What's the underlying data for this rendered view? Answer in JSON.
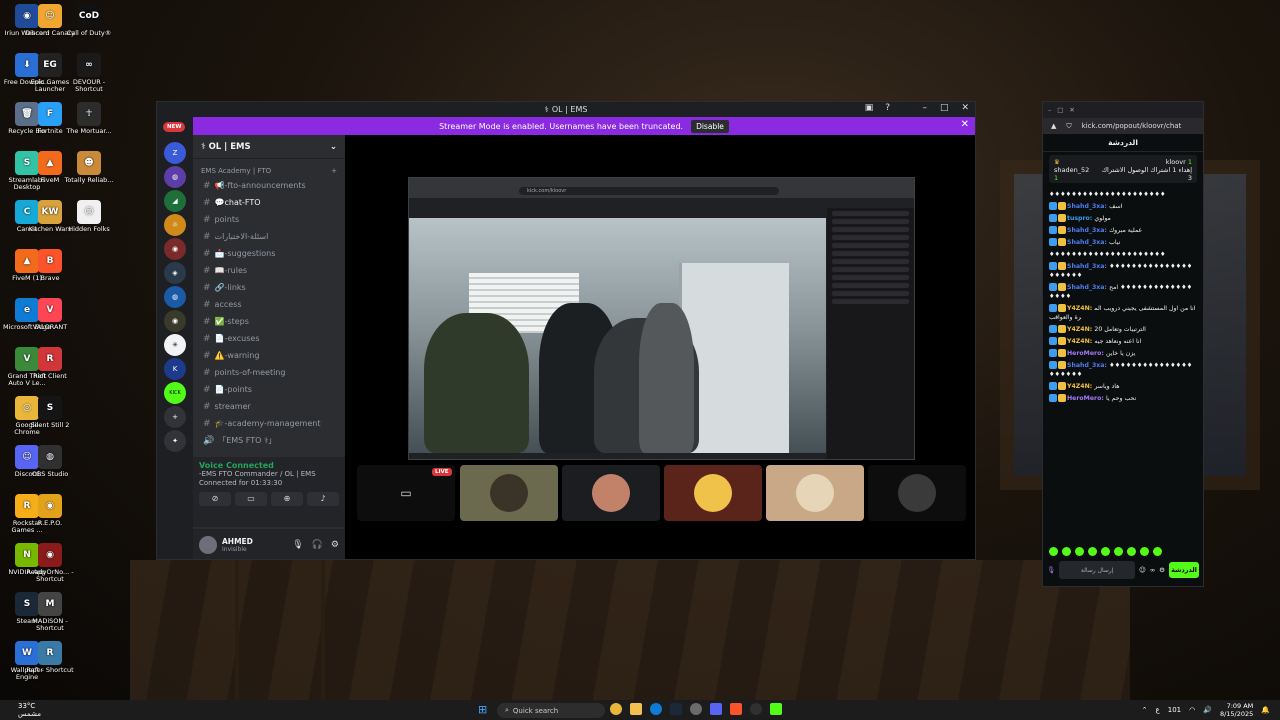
{
  "desktop": {
    "icons": [
      {
        "label": "Iriun Webcam",
        "color": "#1f4b99",
        "glyph": "◉"
      },
      {
        "label": "Discord Canary",
        "color": "#f0a732",
        "glyph": "☺"
      },
      {
        "label": "Call of Duty®",
        "color": "#111111",
        "glyph": "CoD"
      },
      {
        "label": "Free Downlo...",
        "color": "#2a6fd6",
        "glyph": "⬇"
      },
      {
        "label": "Epic Games Launcher",
        "color": "#222222",
        "glyph": "EG"
      },
      {
        "label": "DEVOUR - Shortcut",
        "color": "#1a1a1a",
        "glyph": "∞"
      },
      {
        "label": "Recycle Bin",
        "color": "#5b6f8a",
        "glyph": "🗑"
      },
      {
        "label": "Fortnite",
        "color": "#29a0f5",
        "glyph": "F"
      },
      {
        "label": "The Mortuar...",
        "color": "#2c2c2c",
        "glyph": "☥"
      },
      {
        "label": "Streamlabs Desktop",
        "color": "#32c3a6",
        "glyph": "S"
      },
      {
        "label": "FiveM",
        "color": "#f26b1d",
        "glyph": "▲"
      },
      {
        "label": "Totally Reliab...",
        "color": "#c98a3a",
        "glyph": "☻"
      },
      {
        "label": "Canva",
        "color": "#14a9d6",
        "glyph": "C"
      },
      {
        "label": "Kitchen Wars",
        "color": "#d9a23c",
        "glyph": "KW"
      },
      {
        "label": "Hidden Folks",
        "color": "#f0f0f0",
        "glyph": "☺"
      },
      {
        "label": "FiveM (1)",
        "color": "#f26b1d",
        "glyph": "▲"
      },
      {
        "label": "Brave",
        "color": "#fb542b",
        "glyph": "B"
      },
      {
        "label": "Microsoft Edge",
        "color": "#0f7bd4",
        "glyph": "e"
      },
      {
        "label": "VALORANT",
        "color": "#ff4655",
        "glyph": "V"
      },
      {
        "label": "Grand Theft Auto V Le...",
        "color": "#3a8a3a",
        "glyph": "V"
      },
      {
        "label": "Riot Client",
        "color": "#d13639",
        "glyph": "R"
      },
      {
        "label": "Google Chrome",
        "color": "#e9b63b",
        "glyph": "◎"
      },
      {
        "label": "Silent Still 2",
        "color": "#151515",
        "glyph": "S"
      },
      {
        "label": "Discord",
        "color": "#5865f2",
        "glyph": "☺"
      },
      {
        "label": "OBS Studio",
        "color": "#303030",
        "glyph": "◍"
      },
      {
        "label": "Rockstar Games ...",
        "color": "#f6ad1a",
        "glyph": "R"
      },
      {
        "label": "R.E.P.O.",
        "color": "#e2a21a",
        "glyph": "◉"
      },
      {
        "label": "NVIDIA App",
        "color": "#76b900",
        "glyph": "N"
      },
      {
        "label": "ReadyOrNo... - Shortcut",
        "color": "#8b1a1a",
        "glyph": "◉"
      },
      {
        "label": "Steam",
        "color": "#1b2838",
        "glyph": "S"
      },
      {
        "label": "MADiSON - Shortcut",
        "color": "#444444",
        "glyph": "M"
      },
      {
        "label": "Wallpaper Engine",
        "color": "#2a6fd6",
        "glyph": "W"
      },
      {
        "label": "Raft - Shortcut",
        "color": "#3a7aa6",
        "glyph": "R"
      }
    ]
  },
  "discord": {
    "title": "OL | EMS",
    "new_badge": "NEW",
    "banner_text": "Streamer Mode is enabled. Usernames have been truncated.",
    "banner_button": "Disable",
    "server_name": "OL | EMS",
    "category": "EMS Academy | FTO",
    "channels": [
      {
        "icon": "#",
        "name": "📢-fto-announcements"
      },
      {
        "icon": "#",
        "name": "💬chat-FTO",
        "active": true
      },
      {
        "icon": "#",
        "name": "points"
      },
      {
        "icon": "#",
        "name": "اسئلة-الاختبارات"
      },
      {
        "icon": "#",
        "name": "📩-suggestions"
      },
      {
        "icon": "#",
        "name": "📖-rules"
      },
      {
        "icon": "#",
        "name": "🔗-links"
      },
      {
        "icon": "#",
        "name": "access"
      },
      {
        "icon": "#",
        "name": "✅-steps"
      },
      {
        "icon": "#",
        "name": "📄-excuses"
      },
      {
        "icon": "#",
        "name": "⚠️-warning"
      },
      {
        "icon": "#",
        "name": "points-of-meeting"
      },
      {
        "icon": "#",
        "name": "📄-points"
      },
      {
        "icon": "#",
        "name": "streamer"
      },
      {
        "icon": "#",
        "name": "🎓-academy-management"
      },
      {
        "icon": "🔊",
        "name": "「EMS FTO ⚕」"
      }
    ],
    "voice": {
      "status": "Voice Connected",
      "channel": "-EMS FTO Commander / OL | EMS",
      "timer": "Connected for 01:33:30"
    },
    "user": {
      "name": "AHMED",
      "status": "Invisible"
    },
    "stream": {
      "url": "kick.com/kloovr",
      "live_label": "LIVE"
    }
  },
  "kick": {
    "url": "kick.com/popout/kloovr/chat",
    "header": "الدردشة",
    "pinned_user": "shaden_52",
    "pinned_host": "kloovr",
    "pinned_text": "إهداء 1 اشتراك الوصول الاشتراك 3",
    "pinned_count_a": "1",
    "pinned_count_b": "1",
    "messages": [
      {
        "user": "",
        "text": "♦♦♦♦♦♦♦♦♦♦♦♦♦♦♦♦♦♦♦♦♦",
        "color": "#cfcfcf"
      },
      {
        "user": "Shahd_3xa:",
        "text": "اسف",
        "color": "#4f7df0"
      },
      {
        "user": "tuspro:",
        "text": "مولوي",
        "color": "#3c9cf0"
      },
      {
        "user": "Shahd_3xa:",
        "text": "عملية مبروك",
        "color": "#4f7df0"
      },
      {
        "user": "Shahd_3xa:",
        "text": "نياب",
        "color": "#4f7df0"
      },
      {
        "user": "",
        "text": "♦♦♦♦♦♦♦♦♦♦♦♦♦♦♦♦♦♦♦♦♦",
        "color": "#cfcfcf"
      },
      {
        "user": "Shahd_3xa:",
        "text": "♦♦♦♦♦♦♦♦♦♦♦♦♦♦♦♦♦♦♦♦♦",
        "color": "#4f7df0"
      },
      {
        "user": "Shahd_3xa:",
        "text": "امح ♦♦♦♦♦♦♦♦♦♦♦♦♦♦♦♦♦",
        "color": "#4f7df0"
      },
      {
        "user": "Y4Z4N:",
        "text": "انا من اول المستشفى يجيني درويب المرة والعواقب",
        "color": "#f0c040"
      },
      {
        "user": "Y4Z4N:",
        "text": "الترتيبات وتعامل 20",
        "color": "#f0c040"
      },
      {
        "user": "Y4Z4N:",
        "text": "انا اعنه ونعاهد جيه",
        "color": "#f0c040"
      },
      {
        "user": "HeroMero:",
        "text": "يزن يا خاين",
        "color": "#a37af7"
      },
      {
        "user": "Shahd_3xa:",
        "text": "♦♦♦♦♦♦♦♦♦♦♦♦♦♦♦♦♦♦♦♦♦",
        "color": "#4f7df0"
      },
      {
        "user": "Y4Z4N:",
        "text": "هاد وياسر",
        "color": "#f0c040"
      },
      {
        "user": "HeroMero:",
        "text": "نحب وحم يا",
        "color": "#a37af7"
      }
    ],
    "send_label": "الدردشة",
    "input_placeholder": "إرسال رسالة"
  },
  "taskbar": {
    "weather_temp": "33°C",
    "weather_desc": "مشمس",
    "search_placeholder": "Quick search",
    "time": "7:09 AM",
    "date": "8/15/2025",
    "lang": "ع",
    "battery": "101"
  }
}
